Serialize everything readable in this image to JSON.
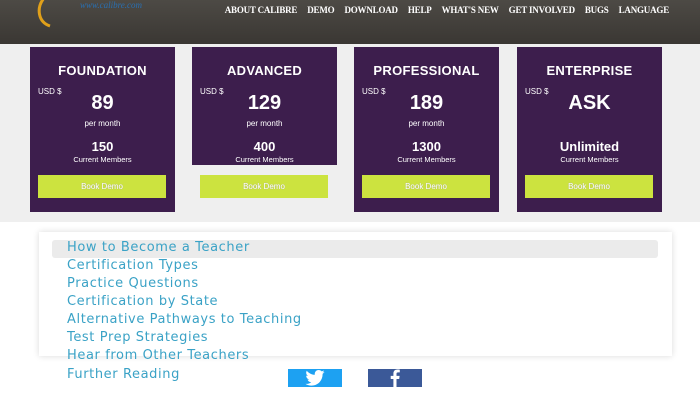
{
  "header": {
    "logo_text": "www.calibre.com",
    "nav": [
      "About Calibre",
      "Demo",
      "Download",
      "Help",
      "What's New",
      "Get Involved",
      "Bugs",
      "Language"
    ]
  },
  "pricing": {
    "cards": [
      {
        "title": "FOUNDATION",
        "currency": "USD $",
        "price": "89",
        "period": "per month",
        "members": "150",
        "members_label": "Current Members",
        "button": "Book Demo"
      },
      {
        "title": "ADVANCED",
        "currency": "USD $",
        "price": "129",
        "period": "per month",
        "members": "400",
        "members_label": "Current Members",
        "button": "Book Demo"
      },
      {
        "title": "PROFESSIONAL",
        "currency": "USD $",
        "price": "189",
        "period": "per month",
        "members": "1300",
        "members_label": "Current Members",
        "button": "Book Demo"
      },
      {
        "title": "ENTERPRISE",
        "currency": "USD $",
        "price": "ASK",
        "period": "",
        "members": "Unlimited",
        "members_label": "Current Members",
        "button": "Book Demo"
      }
    ]
  },
  "links": [
    "How to Become a Teacher",
    "Certification Types",
    "Practice Questions",
    "Certification by State",
    "Alternative Pathways to Teaching",
    "Test Prep Strategies",
    "Hear from Other Teachers",
    "Further Reading"
  ],
  "social": {
    "twitter_icon": "twitter-bird-icon",
    "facebook_icon": "facebook-f-icon"
  },
  "colors": {
    "card_bg": "#3d1e4d",
    "button": "#cce33f",
    "link": "#3aa2c6",
    "twitter": "#1da1f2",
    "facebook": "#3b5998"
  }
}
